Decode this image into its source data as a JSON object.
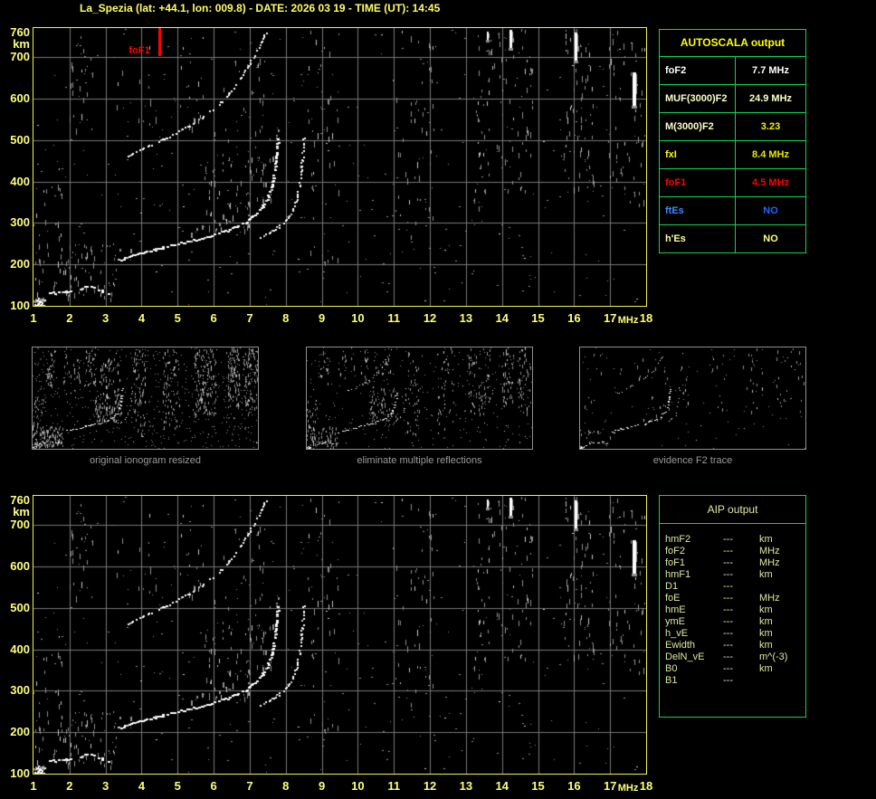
{
  "window": {
    "title": "La_Spezia (lat: +44.1, lon: 009.8) - DATE: 2026 03 19 - TIME (UT): 14:45"
  },
  "colors": {
    "background": "#000000",
    "title_yellow": "#ffff66",
    "axis_yellow": "#ffff7d",
    "plot_border_yellow": "#f2f24a",
    "grid_gray": "#787878",
    "noise_gray": "#909090",
    "trace_white": "#ffffff",
    "panel_border_green": "#0bd653",
    "caption_gray": "#9a9a9a",
    "marker_red": "#ff0000"
  },
  "marker": {
    "label": "foF1",
    "f": 4.5,
    "color": "#ff0000"
  },
  "axes": {
    "y_unit": "km",
    "x_unit": "MHz",
    "y_ticks": [
      760,
      700,
      600,
      500,
      400,
      300,
      200,
      100
    ],
    "x_ticks": [
      1,
      2,
      3,
      4,
      5,
      6,
      7,
      8,
      9,
      10,
      11,
      12,
      13,
      14,
      15,
      16,
      17,
      18
    ]
  },
  "autoscala": {
    "title": "AUTOSCALA output",
    "rows": [
      {
        "label": "foF2",
        "value": "7.7 MHz",
        "label_color": "#ffffff",
        "value_color": "#ffffff"
      },
      {
        "label": "MUF(3000)F2",
        "value": "24.9 MHz",
        "label_color": "#ffffc8",
        "value_color": "#ffffc8"
      },
      {
        "label": "M(3000)F2",
        "value": "3.23",
        "label_color": "#ffffc8",
        "value_color": "#f0f000"
      },
      {
        "label": "fxI",
        "value": "8.4 MHz",
        "label_color": "#ffff00",
        "value_color": "#e8e800"
      },
      {
        "label": "foF1",
        "value": "4.5 MHz",
        "label_color": "#ff0000",
        "value_color": "#ff0000"
      },
      {
        "label": "ftEs",
        "value": "NO",
        "label_color": "#4488ff",
        "value_color": "#2266ff"
      },
      {
        "label": "h'Es",
        "value": "NO",
        "label_color": "#ffff99",
        "value_color": "#ffff80"
      }
    ]
  },
  "aip": {
    "title": "AIP output",
    "rows": [
      {
        "label": "hmF2",
        "value": "---",
        "unit": "km"
      },
      {
        "label": "foF2",
        "value": "---",
        "unit": "MHz"
      },
      {
        "label": "foF1",
        "value": "---",
        "unit": "MHz"
      },
      {
        "label": "hmF1",
        "value": "---",
        "unit": "km"
      },
      {
        "label": "D1",
        "value": "---",
        "unit": ""
      },
      {
        "label": "foE",
        "value": "---",
        "unit": "MHz"
      },
      {
        "label": "hmE",
        "value": "---",
        "unit": "km"
      },
      {
        "label": "ymE",
        "value": "---",
        "unit": "km"
      },
      {
        "label": "h_vE",
        "value": "---",
        "unit": "km"
      },
      {
        "label": "Ewidth",
        "value": "---",
        "unit": "km"
      },
      {
        "label": "DelN_vE",
        "value": "---",
        "unit": "m^(-3)"
      },
      {
        "label": "B0",
        "value": "---",
        "unit": "km"
      },
      {
        "label": "B1",
        "value": "---",
        "unit": ""
      }
    ]
  },
  "thumbnails": [
    {
      "caption": "original ionogram resized"
    },
    {
      "caption": "eliminate multiple reflections"
    },
    {
      "caption": "evidence F2 trace"
    }
  ],
  "chart_data": {
    "type": "scatter",
    "title": "Vertical incidence ionogram, virtual height (km) vs sounding frequency (MHz)",
    "xlabel": "MHz",
    "ylabel": "km",
    "xlim": [
      1,
      18
    ],
    "ylim": [
      100,
      770
    ],
    "grid": true,
    "km_top": 770,
    "uniform_noise_count": 380,
    "series": [
      {
        "name": "E-region near-range echo blob",
        "style": "blob",
        "n": 45,
        "points": [
          [
            1.0,
            100
          ],
          [
            1.3,
            120
          ]
        ]
      },
      {
        "name": "E-layer trace",
        "style": "dash",
        "w": 3,
        "h": 2,
        "skip": 0.3,
        "points": [
          [
            1.42,
            130
          ],
          [
            1.65,
            134
          ],
          [
            1.9,
            136
          ],
          [
            2.1,
            139
          ],
          [
            2.3,
            144
          ],
          [
            2.5,
            149
          ],
          [
            2.65,
            146
          ],
          [
            2.8,
            139
          ],
          [
            2.95,
            134
          ],
          [
            3.1,
            131
          ]
        ]
      },
      {
        "name": "F2 ordinary trace (foF2 7.7 MHz)",
        "style": "solid",
        "w": 3,
        "h": 2,
        "skip": 0.12,
        "halo": true,
        "points": [
          [
            3.35,
            212
          ],
          [
            3.6,
            219
          ],
          [
            3.9,
            227
          ],
          [
            4.25,
            235
          ],
          [
            4.6,
            243
          ],
          [
            5.0,
            251
          ],
          [
            5.4,
            259
          ],
          [
            5.8,
            268
          ],
          [
            6.15,
            277
          ],
          [
            6.45,
            286
          ],
          [
            6.7,
            296
          ],
          [
            6.95,
            308
          ],
          [
            7.15,
            322
          ],
          [
            7.32,
            339
          ],
          [
            7.46,
            360
          ],
          [
            7.57,
            386
          ],
          [
            7.65,
            417
          ],
          [
            7.71,
            452
          ],
          [
            7.75,
            487
          ],
          [
            7.77,
            510
          ]
        ]
      },
      {
        "name": "F2 extraordinary trace (fxI 8.4 MHz)",
        "style": "solid",
        "w": 2,
        "h": 2,
        "skip": 0.2,
        "points": [
          [
            7.3,
            268
          ],
          [
            7.55,
            279
          ],
          [
            7.8,
            292
          ],
          [
            8.0,
            308
          ],
          [
            8.15,
            328
          ],
          [
            8.27,
            353
          ],
          [
            8.35,
            383
          ],
          [
            8.41,
            418
          ],
          [
            8.45,
            455
          ],
          [
            8.48,
            495
          ],
          [
            8.49,
            512
          ]
        ]
      },
      {
        "name": "Second-hop F2 echo (multiple reflection)",
        "style": "dots",
        "w": 2,
        "h": 2,
        "skip": 0.35,
        "points": [
          [
            3.6,
            460
          ],
          [
            3.95,
            477
          ],
          [
            4.3,
            492
          ],
          [
            4.65,
            506
          ],
          [
            5.0,
            521
          ],
          [
            5.35,
            538
          ],
          [
            5.7,
            557
          ],
          [
            6.0,
            578
          ],
          [
            6.3,
            602
          ],
          [
            6.55,
            628
          ],
          [
            6.78,
            656
          ],
          [
            7.0,
            688
          ],
          [
            7.2,
            718
          ],
          [
            7.35,
            744
          ],
          [
            7.45,
            763
          ]
        ]
      }
    ],
    "streaks": [
      {
        "f": 13.58,
        "km1": 742,
        "km2": 762,
        "w": 2
      },
      {
        "f": 14.22,
        "km1": 722,
        "km2": 766,
        "w": 3
      },
      {
        "f": 16.02,
        "km1": 692,
        "km2": 760,
        "w": 3
      },
      {
        "f": 17.63,
        "km1": 583,
        "km2": 663,
        "w": 4
      }
    ],
    "noise_bands": [
      {
        "f1": 1.0,
        "f2": 3.3,
        "km1": 118,
        "km2": 250,
        "n": 80
      },
      {
        "f1": 1.0,
        "f2": 1.8,
        "km1": 250,
        "km2": 450,
        "n": 18
      },
      {
        "f1": 2.0,
        "f2": 2.65,
        "km1": 520,
        "km2": 770,
        "n": 22
      },
      {
        "f1": 3.3,
        "f2": 4.6,
        "km1": 540,
        "km2": 730,
        "n": 14
      },
      {
        "f1": 5.0,
        "f2": 5.75,
        "km1": 520,
        "km2": 760,
        "n": 20
      },
      {
        "f1": 5.7,
        "f2": 7.7,
        "km1": 285,
        "km2": 470,
        "n": 70
      },
      {
        "f1": 6.0,
        "f2": 7.6,
        "km1": 480,
        "km2": 700,
        "n": 25
      },
      {
        "f1": 8.6,
        "f2": 9.5,
        "km1": 180,
        "km2": 770,
        "n": 45
      },
      {
        "f1": 10.8,
        "f2": 12.1,
        "km1": 230,
        "km2": 770,
        "n": 50
      },
      {
        "f1": 13.2,
        "f2": 14.85,
        "km1": 330,
        "km2": 770,
        "n": 95
      },
      {
        "f1": 15.7,
        "f2": 16.6,
        "km1": 380,
        "km2": 770,
        "n": 65
      },
      {
        "f1": 16.9,
        "f2": 17.95,
        "km1": 330,
        "km2": 770,
        "n": 60
      }
    ]
  }
}
